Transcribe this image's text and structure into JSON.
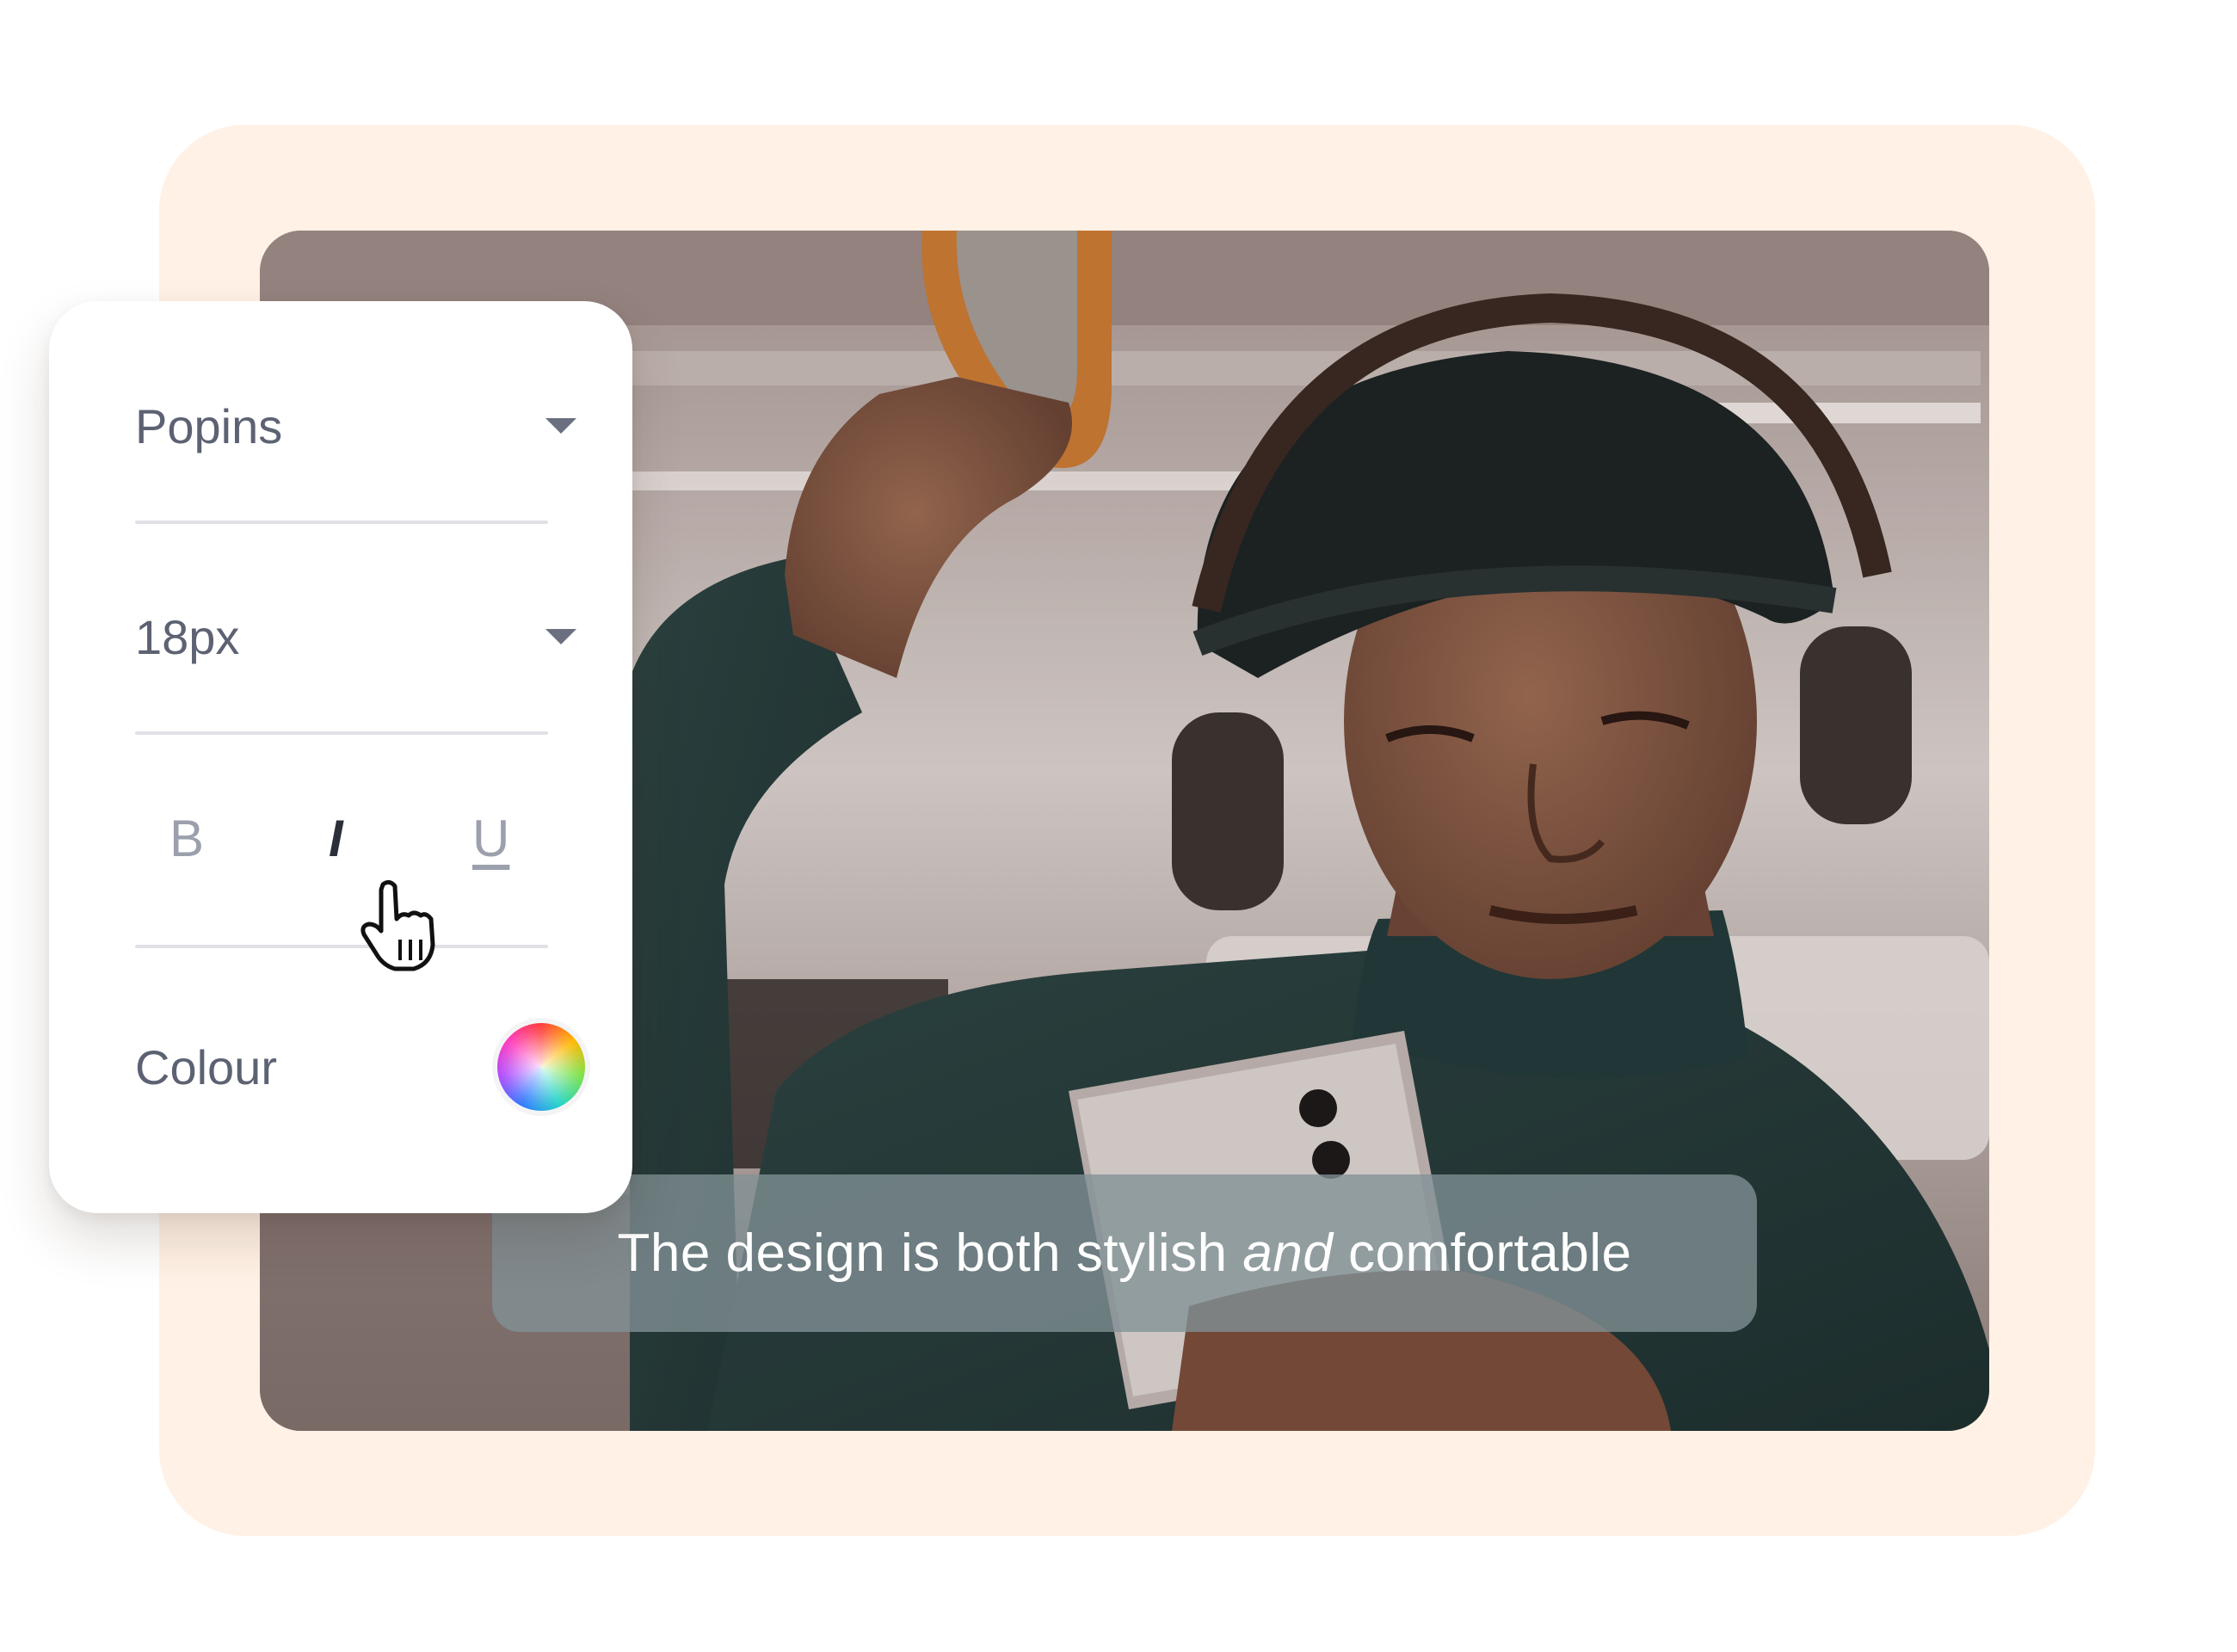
{
  "panel": {
    "font_select": {
      "value": "Popins"
    },
    "size_select": {
      "value": "18px"
    },
    "format": {
      "bold_label": "B",
      "italic_label": "I",
      "underline_label": "U"
    },
    "colour": {
      "label": "Colour"
    }
  },
  "caption": {
    "before": "The design is both stylish ",
    "emphasis": "and",
    "after": " comfortable"
  },
  "colors": {
    "backdrop": "#fff1e5",
    "panel_text": "#5d6273",
    "active_format": "#2b2f3a",
    "inactive_format": "#9ca0ac"
  },
  "icons": {
    "dropdown": "chevron-down-icon",
    "pointer": "hand-pointer-icon",
    "colour": "color-wheel-icon"
  }
}
